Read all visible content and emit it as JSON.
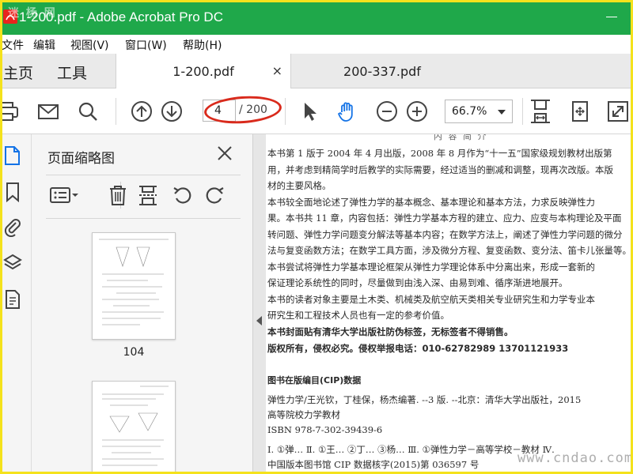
{
  "window": {
    "title": "1-200.pdf - Adobe Acrobat Pro DC",
    "logo_watermark": "迷 杨 网"
  },
  "menubar": {
    "items": [
      "文件",
      "编辑",
      "视图(V)",
      "窗口(W)",
      "帮助(H)"
    ]
  },
  "tabs": {
    "home": "主页",
    "tools": "工具",
    "documents": [
      {
        "label": "1-200.pdf",
        "active": true,
        "close": "×"
      },
      {
        "label": "200-337.pdf",
        "active": false
      }
    ]
  },
  "toolbar": {
    "page_number": "4",
    "page_total": "/ 200",
    "zoom_level": "66.7%",
    "icons": [
      "print-icon",
      "email-icon",
      "search-icon",
      "page-up-icon",
      "page-down-icon",
      "select-cursor-icon",
      "hand-tool-icon",
      "zoom-out-icon",
      "zoom-in-icon",
      "fit-page-icon",
      "fit-width-icon",
      "fullscreen-icon"
    ]
  },
  "leftstrip": {
    "icons": [
      "page-thumbnails-icon",
      "bookmarks-icon",
      "attachments-icon",
      "layers-icon",
      "document-properties-icon"
    ]
  },
  "thumbnails_panel": {
    "title": "页面缩略图",
    "tools": [
      "options-icon",
      "delete-icon",
      "extract-icon",
      "rotate-left-icon",
      "rotate-right-icon"
    ],
    "pages": [
      {
        "label": "104"
      },
      {
        "label": ""
      }
    ]
  },
  "document": {
    "heading": "内 容 简 介",
    "intro_lines": [
      "    本书第 1 版于 2004 年 4 月出版，2008 年 8 月作为“十一五”国家级规划教材出版第",
      "用，并考虑到精简学时后教学的实际需要，经过适当的删减和调整，现再次改版。本版",
      "材的主要风格。",
      "    本书较全面地论述了弹性力学的基本概念、基本理论和基本方法，力求反映弹性力",
      "果。本书共 11 章，内容包括：弹性力学基本方程的建立、应力、应变与本构理论及平面",
      "转问题、弹性力学问题变分解法等基本内容；在数学方法上，阐述了弹性力学问题的微分",
      "法与复变函数方法；在数学工具方面，涉及微分方程、复变函数、变分法、笛卡儿张量等。",
      "    本书尝试将弹性力学基本理论框架从弹性力学理论体系中分离出来，形成一套新的",
      "保证理论系统性的同时，尽量做到由浅入深、由易到难、循序渐进地展开。",
      "    本书的读者对象主要是土木类、机械类及航空航天类相关专业研究生和力学专业本",
      "研究生和工程技术人员也有一定的参考价值。"
    ],
    "notice_lines": [
      "本书封面贴有清华大学出版社防伪标签，无标签者不得销售。",
      "版权所有，侵权必究。侵权举报电话：010-62782989   13701121933"
    ],
    "cip": {
      "title": "图书在版编目(CIP)数据",
      "lines": [
        "弹性力学/王光钦，丁桂保，杨杰编著. --3 版. --北京：清华大学出版社，2015",
        "高等院校力学教材",
        "ISBN 978-7-302-39439-6",
        "Ⅰ. ①弹…   Ⅱ. ①王…  ②丁…  ③杨…     Ⅲ. ①弹性力学－高等学校－教材   Ⅳ.",
        "中国版本图书馆 CIP 数据核字(2015)第 036597 号"
      ]
    }
  },
  "site_watermark": "www.cndao.com",
  "colors": {
    "titlebar": "#1fa84a",
    "frame": "#f4e21c",
    "highlight": "#d92a1c",
    "hand_tool_active": "#1473e6"
  }
}
